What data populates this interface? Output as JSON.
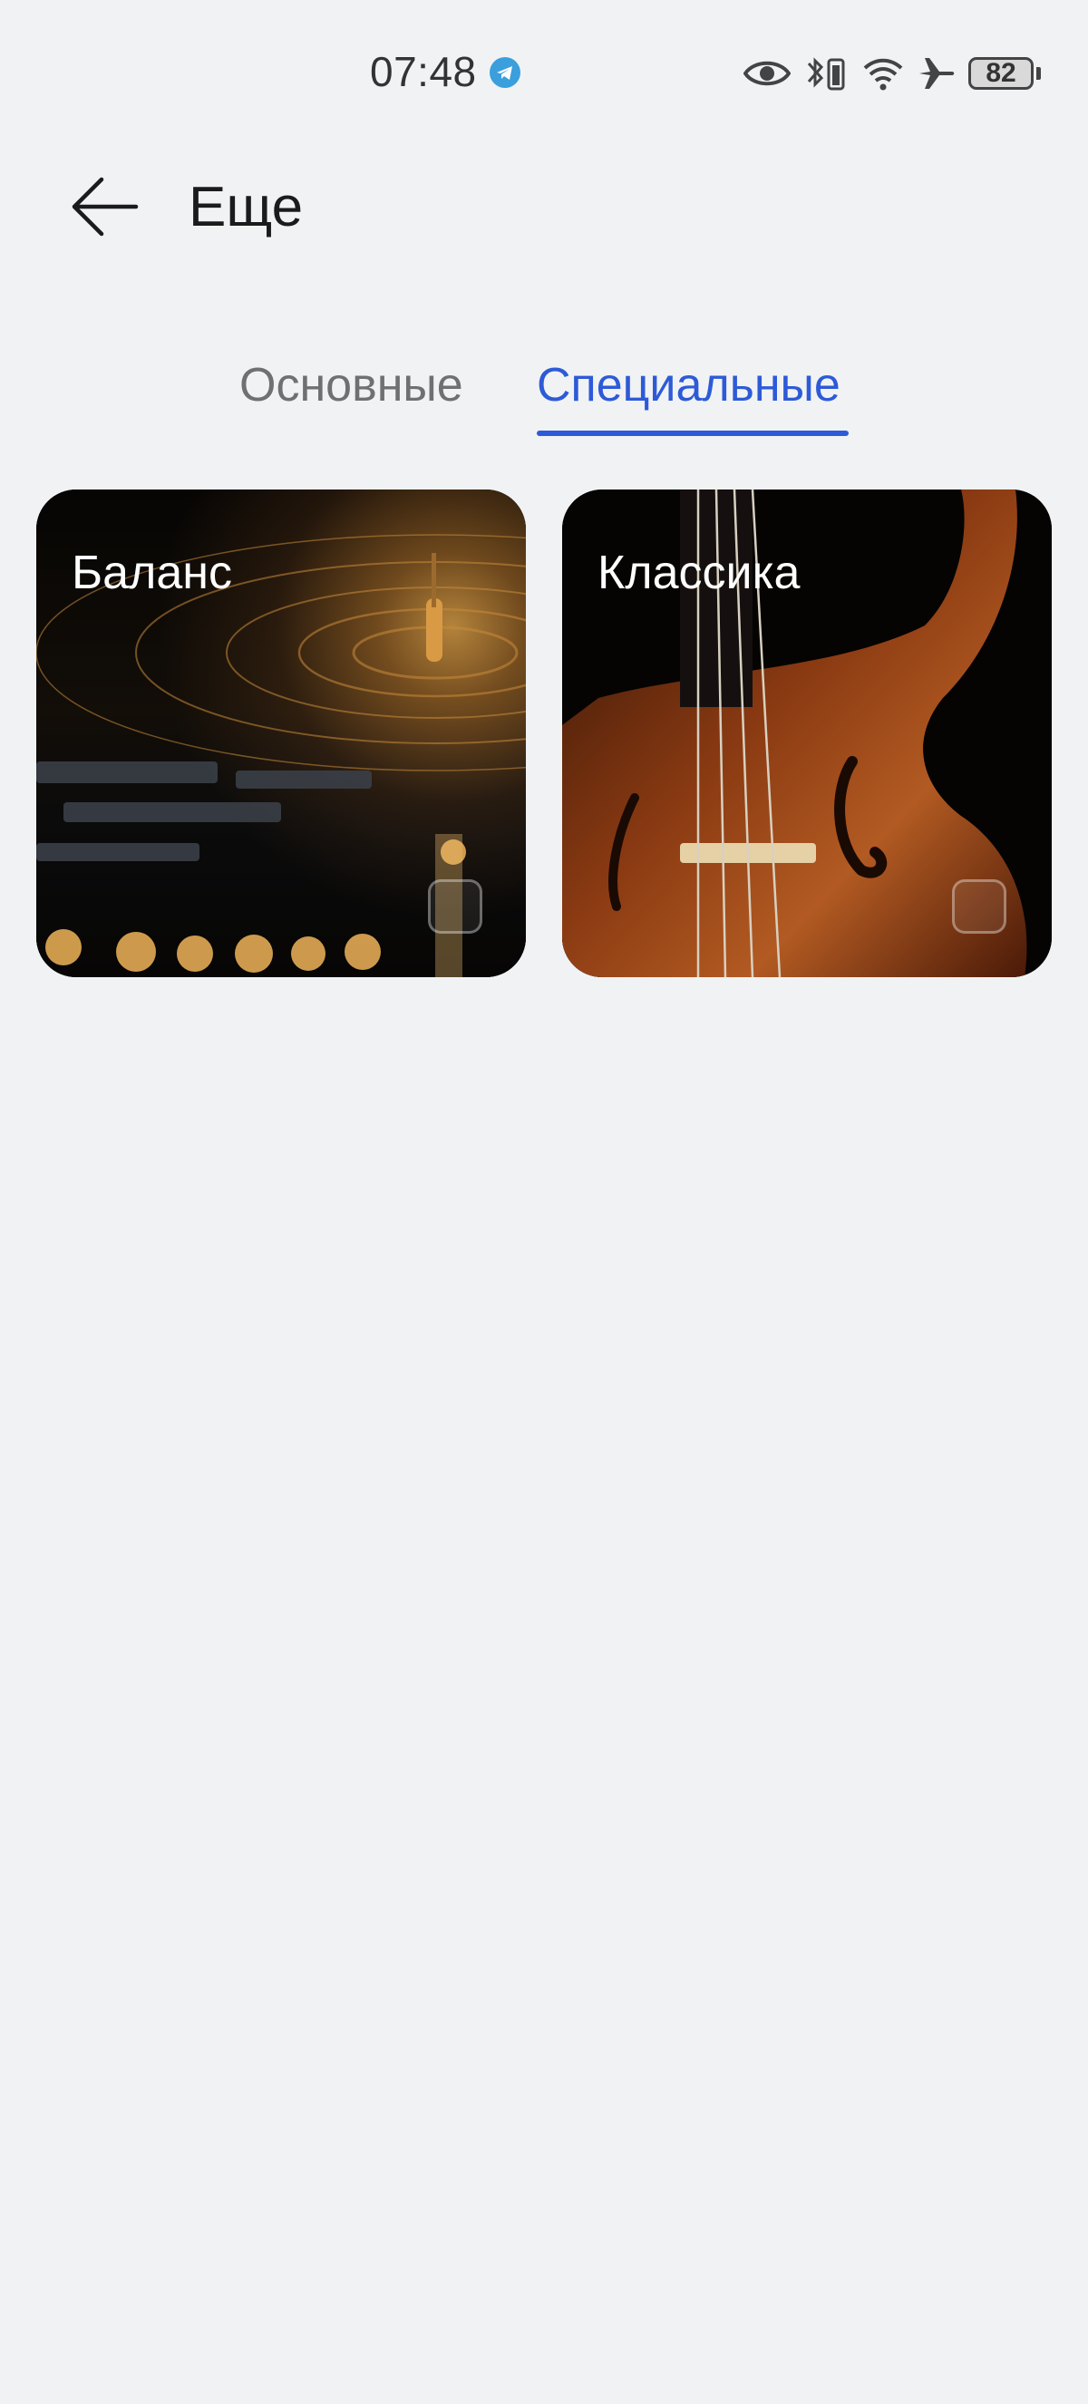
{
  "status_bar": {
    "time": "07:48",
    "battery_level": "82",
    "icons": [
      "telegram-icon",
      "eye-icon",
      "bluetooth-battery-icon",
      "wifi-icon",
      "airplane-icon",
      "battery-icon"
    ]
  },
  "header": {
    "title": "Еще",
    "back_icon": "arrow-left-icon"
  },
  "tabs": [
    {
      "label": "Основные",
      "selected": false
    },
    {
      "label": "Специальные",
      "selected": true
    }
  ],
  "cards": [
    {
      "label": "Баланс",
      "image": "turntable-record",
      "selected": false
    },
    {
      "label": "Классика",
      "image": "violin",
      "selected": false
    }
  ],
  "colors": {
    "accent": "#2d5bd7",
    "background": "#f1f2f4",
    "tab_inactive": "#707070"
  }
}
